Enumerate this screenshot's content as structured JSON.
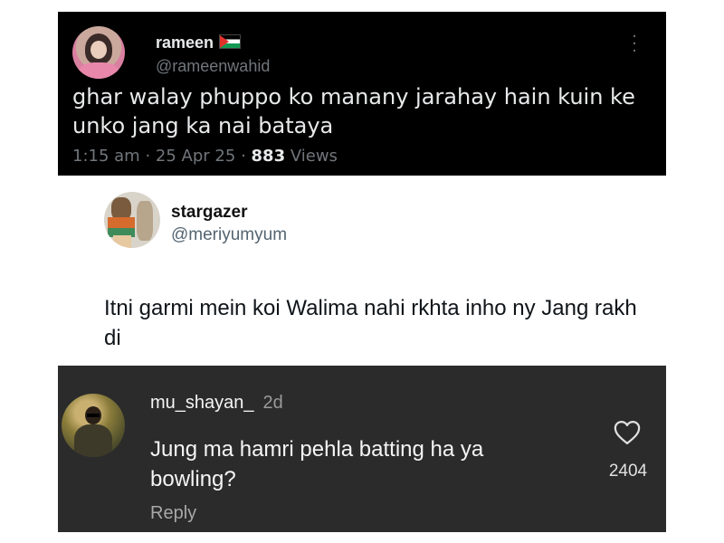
{
  "tweet1": {
    "display_name": "rameen",
    "flag_icon": "palestine-flag-icon",
    "handle": "@rameenwahid",
    "text": "ghar walay phuppo ko manany jarahay hain kuin ke unko jang ka nai bataya",
    "time": "1:15 am",
    "date": "25 Apr 25",
    "views_count": "883",
    "views_label": "Views",
    "separator": "·",
    "theme": {
      "background": "#000000",
      "text": "#e7e9ea",
      "muted": "#71767b"
    }
  },
  "tweet2": {
    "display_name": "stargazer",
    "handle": "@meriyumyum",
    "text": "Itni garmi mein koi Walima nahi rkhta inho ny Jang rakh di",
    "theme": {
      "background": "#ffffff",
      "text": "#0f1419",
      "muted": "#536471"
    }
  },
  "comment": {
    "username": "mu_shayan_",
    "age": "2d",
    "text": "Jung ma hamri pehla batting ha ya bowling?",
    "likes": "2404",
    "reply_label": "Reply",
    "theme": {
      "background": "#2b2b2b",
      "text": "#f5f5f5",
      "muted": "#a8a8a8"
    }
  }
}
